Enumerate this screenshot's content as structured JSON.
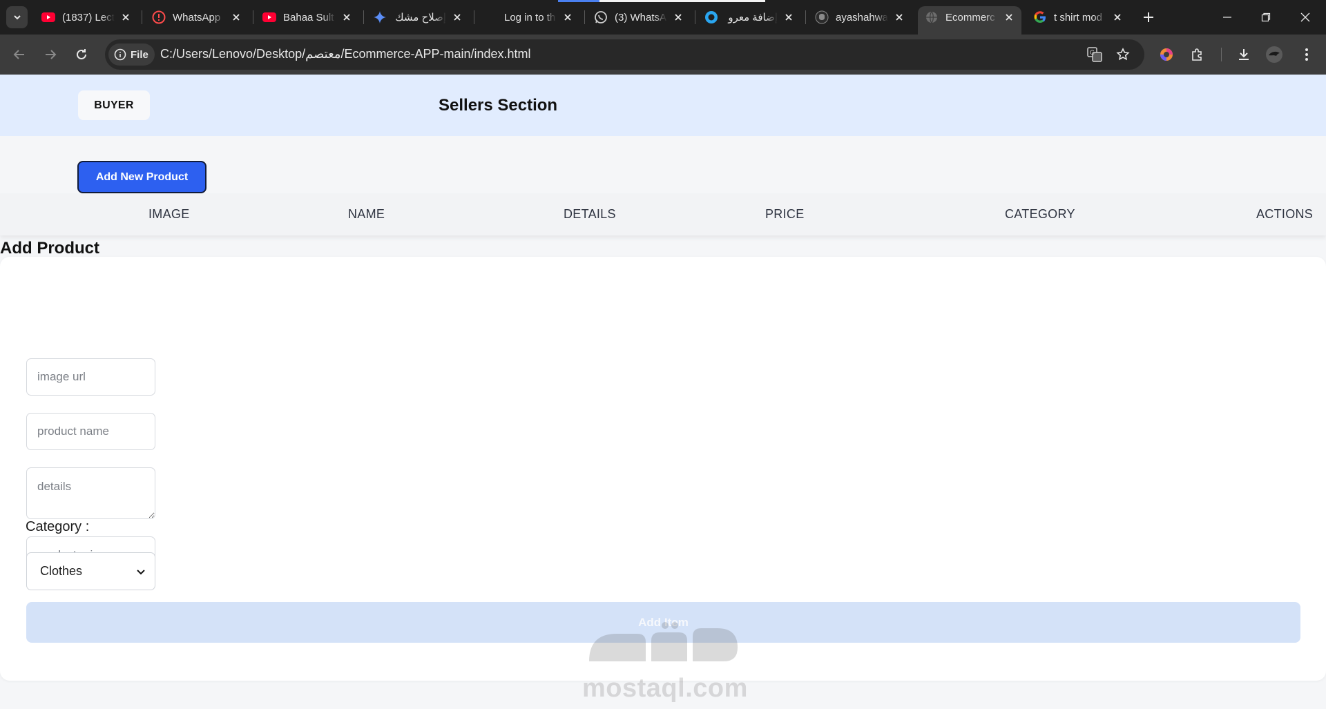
{
  "browser": {
    "tabs": [
      {
        "title": "(1837) Lect",
        "icon": "youtube-icon"
      },
      {
        "title": "WhatsApp",
        "icon": "alert-icon"
      },
      {
        "title": "Bahaa Sult",
        "icon": "youtube-icon"
      },
      {
        "title": "إصلاح مشك",
        "icon": "gemini-icon"
      },
      {
        "title": "Log in to th",
        "icon": "blank-page-icon"
      },
      {
        "title": "(3) WhatsA",
        "icon": "whatsapp-icon"
      },
      {
        "title": "إضافة معرو",
        "icon": "circle-icon"
      },
      {
        "title": "ayashahwa",
        "icon": "github-icon"
      },
      {
        "title": "Ecommerc",
        "icon": "globe-icon",
        "active": true
      },
      {
        "title": "t shirt mod",
        "icon": "google-icon"
      }
    ],
    "address": {
      "scheme_chip": "File",
      "url": "C:/Users/Lenovo/Desktop/معتصم/Ecommerce-APP-main/index.html"
    }
  },
  "header": {
    "buyer_label": "BUYER",
    "title": "Sellers Section"
  },
  "actions": {
    "add_new_label": "Add New Product"
  },
  "table": {
    "columns": [
      "IMAGE",
      "NAME",
      "DETAILS",
      "PRICE",
      "CATEGORY",
      "ACTIONS"
    ]
  },
  "form": {
    "title": "Add Product",
    "image_url_placeholder": "image url",
    "product_name_placeholder": "product name",
    "details_placeholder": "details",
    "price_placeholder": "product price",
    "category_label": "Category :",
    "category_selected": "Clothes",
    "submit_label": "Add Item"
  },
  "watermark": {
    "text": "mostaql.com",
    "logo_text": "مستقل"
  },
  "colors": {
    "header_bg": "#e1ecfe",
    "primary": "#2d60f0",
    "submit_disabled": "#d4e2f8"
  }
}
